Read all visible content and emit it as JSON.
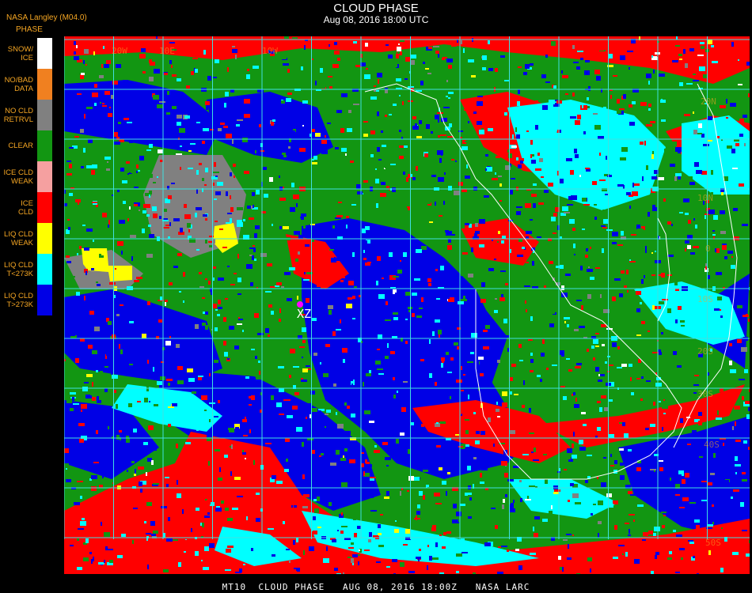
{
  "header": {
    "title": "CLOUD PHASE",
    "subtitle": "Aug 08, 2016 18:00 UTC",
    "product": "NASA Langley (M04.0)"
  },
  "legend": {
    "title": "PHASE",
    "items": [
      {
        "label": "SNOW/ ICE",
        "color": "#ffffff"
      },
      {
        "label": "NO/BAD DATA",
        "color": "#f08020"
      },
      {
        "label": "NO CLD RETRVL",
        "color": "#808080"
      },
      {
        "label": "CLEAR",
        "color": "#129612"
      },
      {
        "label": "ICE CLD WEAK",
        "color": "#f5a0a0"
      },
      {
        "label": "ICE CLD",
        "color": "#ff0000"
      },
      {
        "label": "LIQ CLD WEAK",
        "color": "#ffff00"
      },
      {
        "label": "LIQ CLD T<273K",
        "color": "#00ffff"
      },
      {
        "label": "LIQ CLD T>273K",
        "color": "#0000e6"
      }
    ]
  },
  "map": {
    "marker_label": "XZ",
    "marker_color": "#ff00ff",
    "grid_color": "#40e0e0",
    "coast_color": "#ffffff",
    "grid_labels": [
      "20N",
      "10N",
      "0",
      "10S",
      "20S",
      "30S",
      "40S",
      "50S",
      "20W",
      "10W",
      "10E"
    ]
  },
  "footer": {
    "text": "MT10  CLOUD PHASE   AUG 08, 2016 18:00Z   NASA LARC"
  }
}
